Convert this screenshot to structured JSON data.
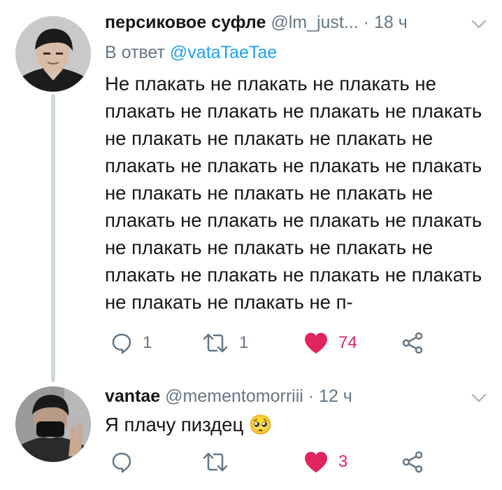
{
  "tweets": [
    {
      "name": "персиковое суфле",
      "handle": "@lm_just...",
      "dot": "·",
      "time": "18 ч",
      "reply_prefix": "В ответ",
      "reply_to": "@vataTaeTae",
      "text": "Не плакать не плакать не плакать не плакать не плакать не плакать не плакать не плакать не плакать не плакать не плакать не плакать не плакать не плакать не плакать не плакать не плакать не плакать не плакать не плакать не плакать не плакать не плакать не плакать не плакать не плакать не плакать не плакать не плакать не плакать не п-",
      "replies": "1",
      "retweets": "1",
      "likes": "74"
    },
    {
      "name": "vantae",
      "handle": "@mementomorriii",
      "dot": "·",
      "time": "12 ч",
      "text": "Я плачу пиздец 🥺",
      "replies": "",
      "retweets": "",
      "likes": "3"
    }
  ],
  "colors": {
    "like": "#e0245e",
    "mention": "#1da1f2",
    "muted": "#657786",
    "thread_line": "#cfd9de"
  }
}
